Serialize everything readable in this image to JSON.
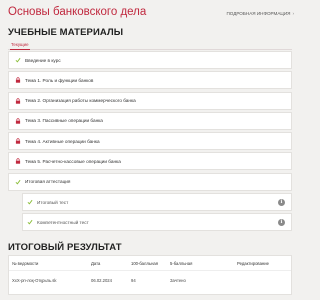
{
  "header": {
    "course_title": "Основы банковского дела",
    "detail_link": "ПОДРОБНАЯ ИНФОРМАЦИЯ",
    "detail_arrow": "›"
  },
  "materials": {
    "title": "УЧЕБНЫЕ МАТЕРИАЛЫ",
    "tab_current": "Текущие",
    "items": [
      {
        "label": "Введение в курс",
        "icon": "check-icon"
      },
      {
        "label": "Тема 1. Роль и функции банков",
        "icon": "lock-icon"
      },
      {
        "label": "Тема 2. Организация работы коммерческого банка",
        "icon": "lock-icon"
      },
      {
        "label": "Тема 3. Пассивные операции банка",
        "icon": "lock-icon"
      },
      {
        "label": "Тема 4. Активные операции банка",
        "icon": "lock-icon"
      },
      {
        "label": "Тема 5. Расчетно-кассовые операции банка",
        "icon": "lock-icon"
      },
      {
        "label": "Итоговая аттестация",
        "icon": "check-icon"
      }
    ],
    "sub_items": [
      {
        "label": "Итоговый тест",
        "icon": "check-icon",
        "info": "i"
      },
      {
        "label": "Компетентностный тест",
        "icon": "check-icon",
        "info": "i"
      }
    ]
  },
  "results": {
    "title": "ИТОГОВЫЙ РЕЗУЛЬТАТ",
    "columns": [
      "№ ведомости",
      "Дата",
      "100-балльная",
      "5-балльная",
      "Редактирование"
    ],
    "row": {
      "number": "ХхХ-рп-лоқ-Отқрьпь.sk",
      "date": "06.02.2024",
      "score100": "94",
      "score5": "Зачтено",
      "edit": ""
    }
  },
  "colors": {
    "brand": "#c0283e",
    "check": "#8dbf3d",
    "lock": "#c0283e",
    "background": "#f2f1ef"
  }
}
